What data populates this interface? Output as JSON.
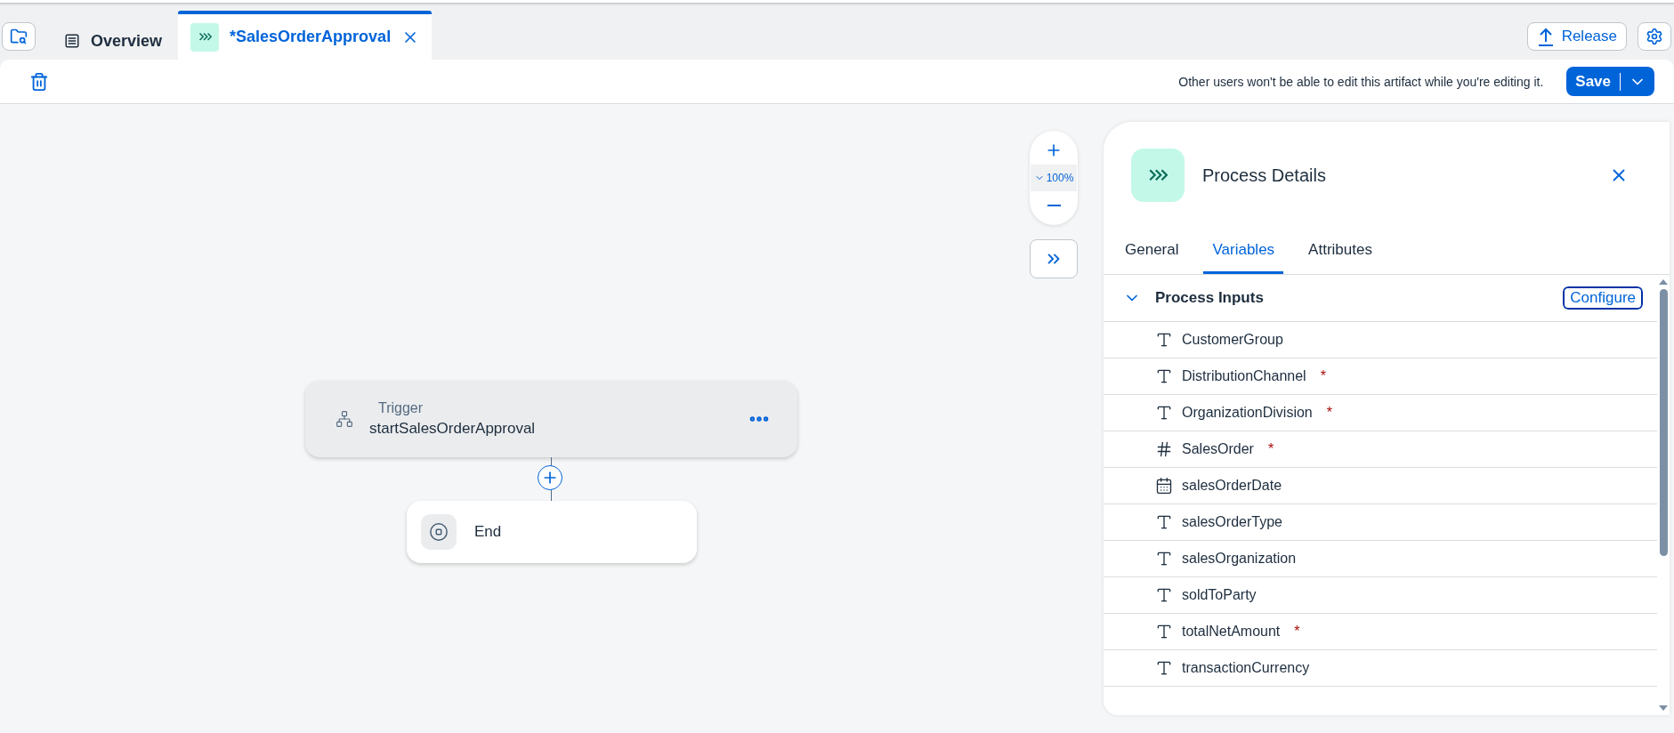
{
  "tabs": [
    {
      "label": "Overview",
      "kind": "overview",
      "selected": false,
      "closable": false
    },
    {
      "label": "*SalesOrderApproval",
      "kind": "process",
      "selected": true,
      "closable": true
    }
  ],
  "release_button": "Release",
  "edit_notice": "Other users won't be able to edit this artifact while you're editing it.",
  "save_button": "Save",
  "zoom": {
    "reading": "100%"
  },
  "nodes": [
    {
      "kind": "trigger",
      "label": "Trigger",
      "name": "startSalesOrderApproval"
    },
    {
      "kind": "end",
      "label": "End"
    }
  ],
  "panel": {
    "title": "Process Details",
    "tabs": [
      {
        "label": "General",
        "selected": false
      },
      {
        "label": "Variables",
        "selected": true
      },
      {
        "label": "Attributes",
        "selected": false
      }
    ],
    "section": {
      "title": "Process Inputs",
      "expanded": true,
      "action": "Configure",
      "items": [
        {
          "name": "CustomerGroup",
          "kind": "text"
        },
        {
          "name": "DistributionChannel",
          "kind": "text",
          "required_mark": "*"
        },
        {
          "name": "OrganizationDivision",
          "kind": "text",
          "required_mark": "*"
        },
        {
          "name": "SalesOrder",
          "kind": "number",
          "required_mark": "*"
        },
        {
          "name": "salesOrderDate",
          "kind": "date"
        },
        {
          "name": "salesOrderType",
          "kind": "text"
        },
        {
          "name": "salesOrganization",
          "kind": "text"
        },
        {
          "name": "soldToParty",
          "kind": "text"
        },
        {
          "name": "totalNetAmount",
          "kind": "text",
          "required_mark": "*"
        },
        {
          "name": "transactionCurrency",
          "kind": "text"
        }
      ]
    }
  }
}
